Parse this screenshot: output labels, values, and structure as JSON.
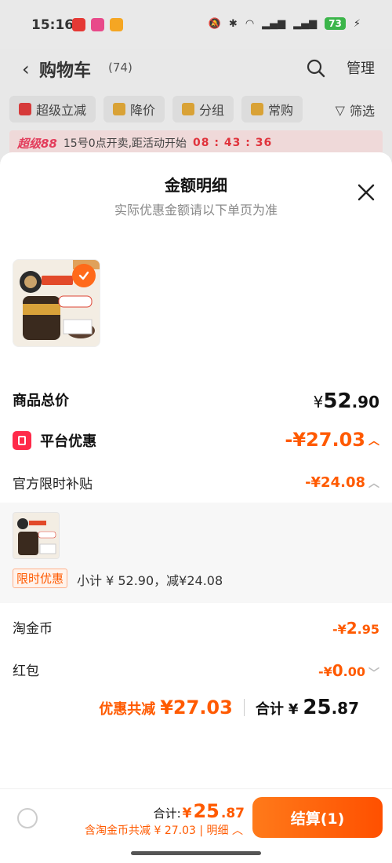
{
  "status_bar": {
    "time": "15:16",
    "battery": "73"
  },
  "cart_page": {
    "title": "购物车",
    "count": "(74)",
    "manage": "管理",
    "filters": [
      "超级立减",
      "降价",
      "分组",
      "常购"
    ],
    "filter_link": "筛选",
    "promo": {
      "logo": "超级88",
      "text": "15号0点开卖,距活动开始",
      "timer": "08 : 43 : 36"
    }
  },
  "sheet": {
    "title": "金额明细",
    "subtitle": "实际优惠金额请以下单页为准",
    "product_total": {
      "label": "商品总价",
      "currency": "¥",
      "int": "52",
      "dec": ".90"
    },
    "platform_discount": {
      "label": "平台优惠",
      "value": "-¥27.03"
    },
    "official_subsidy": {
      "label": "官方限时补贴",
      "value": "-¥24.08"
    },
    "detail": {
      "tag": "限时优惠",
      "subtotal": "小计 ¥ 52.90，减¥24.08"
    },
    "taojinbi": {
      "label": "淘金币",
      "prefix": "-¥",
      "int": "2",
      "dec": ".95"
    },
    "hongbao": {
      "label": "红包",
      "prefix": "-¥",
      "int": "0",
      "dec": ".00"
    },
    "summary": {
      "discount_label": "优惠共减",
      "discount_value": "¥27.03",
      "total_label": "合计",
      "total_currency": "¥",
      "total_int": "25",
      "total_dec": ".87"
    }
  },
  "bottom_bar": {
    "total_label": "合计:",
    "total_currency": "¥",
    "total_int": "25",
    "total_dec": ".87",
    "sub_text": "含淘金币共减 ¥ 27.03 | 明细",
    "checkout": "结算(1)"
  },
  "colors": {
    "accent": "#ff5a00",
    "checkout": "#ff5000"
  }
}
